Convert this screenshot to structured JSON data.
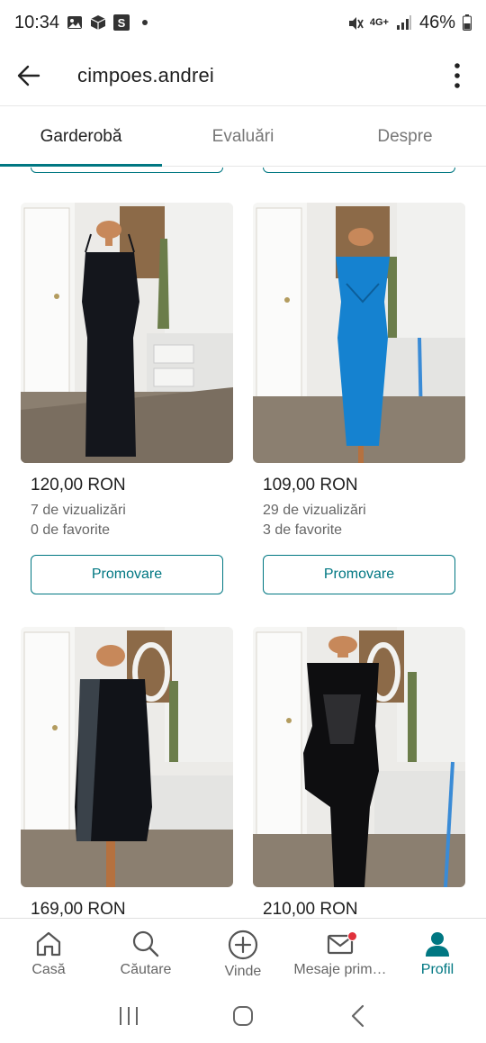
{
  "status_bar": {
    "time": "10:34",
    "network": "4G+",
    "battery": "46%",
    "icons": [
      "image-icon",
      "box-icon",
      "s-app-icon",
      "dot-icon",
      "mute-icon",
      "signal-icon",
      "battery-icon"
    ]
  },
  "app_bar": {
    "title": "cimpoes.andrei",
    "back_icon": "arrow-left-icon",
    "more_icon": "more-vertical-icon"
  },
  "tabs": [
    {
      "label": "Garderobă",
      "active": true
    },
    {
      "label": "Evaluări",
      "active": false
    },
    {
      "label": "Despre",
      "active": false
    }
  ],
  "listings": [
    {
      "price": "120,00 RON",
      "views": "7 de vizualizări",
      "favorites": "0 de favorite",
      "action": "Promovare",
      "dress_color": "#14161c"
    },
    {
      "price": "109,00 RON",
      "views": "29 de vizualizări",
      "favorites": "3 de favorite",
      "action": "Promovare",
      "dress_color": "#1582d0"
    },
    {
      "price": "169,00 RON",
      "dress_color": "#111318"
    },
    {
      "price": "210,00 RON",
      "dress_color": "#0e0e10"
    }
  ],
  "bottom_nav": [
    {
      "label": "Casă",
      "icon": "home-icon",
      "active": false
    },
    {
      "label": "Căutare",
      "icon": "search-icon",
      "active": false
    },
    {
      "label": "Vinde",
      "icon": "plus-circle-icon",
      "active": false
    },
    {
      "label": "Mesaje prim…",
      "icon": "mail-icon",
      "active": false,
      "badge": true
    },
    {
      "label": "Profil",
      "icon": "person-icon",
      "active": true
    }
  ],
  "system_nav": [
    "recents-icon",
    "home-circle-icon",
    "back-chevron-icon"
  ],
  "colors": {
    "accent": "#007782",
    "badge": "#e0313c"
  }
}
